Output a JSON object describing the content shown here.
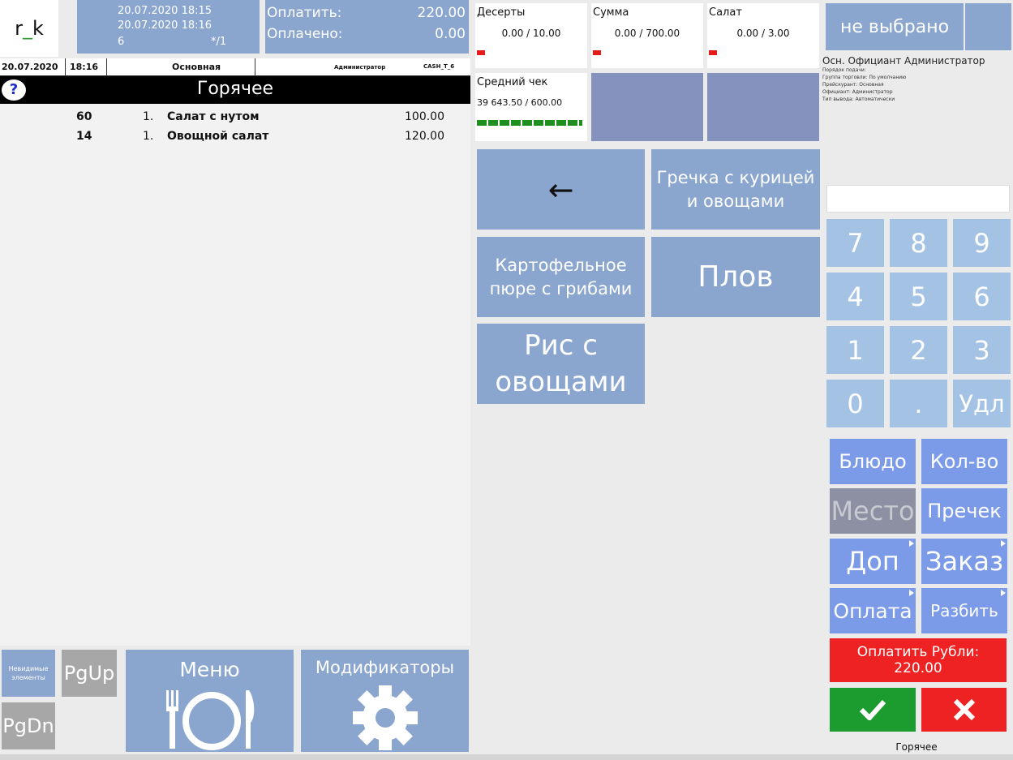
{
  "header": {
    "logo": {
      "prefix": "r",
      "underscore": "_",
      "suffix": "k"
    },
    "order": {
      "opened": "20.07.2020 18:15",
      "updated": "20.07.2020 18:16",
      "table": "6",
      "guests": "*/1"
    },
    "pay": {
      "to_pay_label": "Оплатить:",
      "to_pay_value": "220.00",
      "paid_label": "Оплачено:",
      "paid_value": "0.00"
    }
  },
  "order_header": {
    "date": "20.07.2020",
    "time": "18:16",
    "menu": "Основная",
    "user": "Администратор",
    "station": "CASH_T_6"
  },
  "category": {
    "title": "Горячее",
    "help_icon": "?"
  },
  "order_items": [
    {
      "code": "60",
      "qty": "1.",
      "name": "Салат с нутом",
      "price": "100.00"
    },
    {
      "code": "14",
      "qty": "1.",
      "name": "Овощной салат",
      "price": "120.00"
    }
  ],
  "bottom_left": {
    "hidden_items": "Невидимые элементы",
    "pgup": "PgUp",
    "pgdn": "PgDn",
    "menu": "Меню",
    "modifiers": "Модификаторы"
  },
  "counters": [
    {
      "name": "Десерты",
      "value": "0.00 / 10.00"
    },
    {
      "name": "Сумма",
      "value": "0.00 / 700.00"
    },
    {
      "name": "Салат",
      "value": "0.00 / 3.00"
    }
  ],
  "avg_check": {
    "name": "Средний чек",
    "value": "39 643.50 / 600.00"
  },
  "dishes": {
    "back": "←",
    "d1": "Гречка с курицей и овощами",
    "d2": "Картофельное пюре с грибами",
    "d3": "Плов",
    "d4": "Рис с овощами"
  },
  "right": {
    "not_selected": "не выбрано",
    "staff": "Осн. Официант  Администратор",
    "details": [
      "Порядок подачи:",
      "Группа торговли: По умолчанию",
      "Прейскурант: Основная",
      "Официант: Администратор",
      "Тип вывода: Автоматически"
    ],
    "keypad": [
      "7",
      "8",
      "9",
      "4",
      "5",
      "6",
      "1",
      "2",
      "3",
      "0",
      ".",
      "Удл"
    ],
    "func": {
      "dish": "Блюдо",
      "qty": "Кол-во",
      "place": "Место",
      "precheck": "Пречек",
      "extra": "Доп",
      "order": "Заказ",
      "payment": "Оплата",
      "split": "Разбить"
    },
    "pay_button": {
      "line1": "Оплатить Рубли:",
      "line2": "220.00"
    },
    "footer": "Горячее"
  },
  "colors": {
    "tile_blue": "#8aa6cf",
    "key_blue": "#a4c3e4",
    "func_blue": "#7b9ae8",
    "red": "#ee2222",
    "green": "#1c9b2e"
  }
}
